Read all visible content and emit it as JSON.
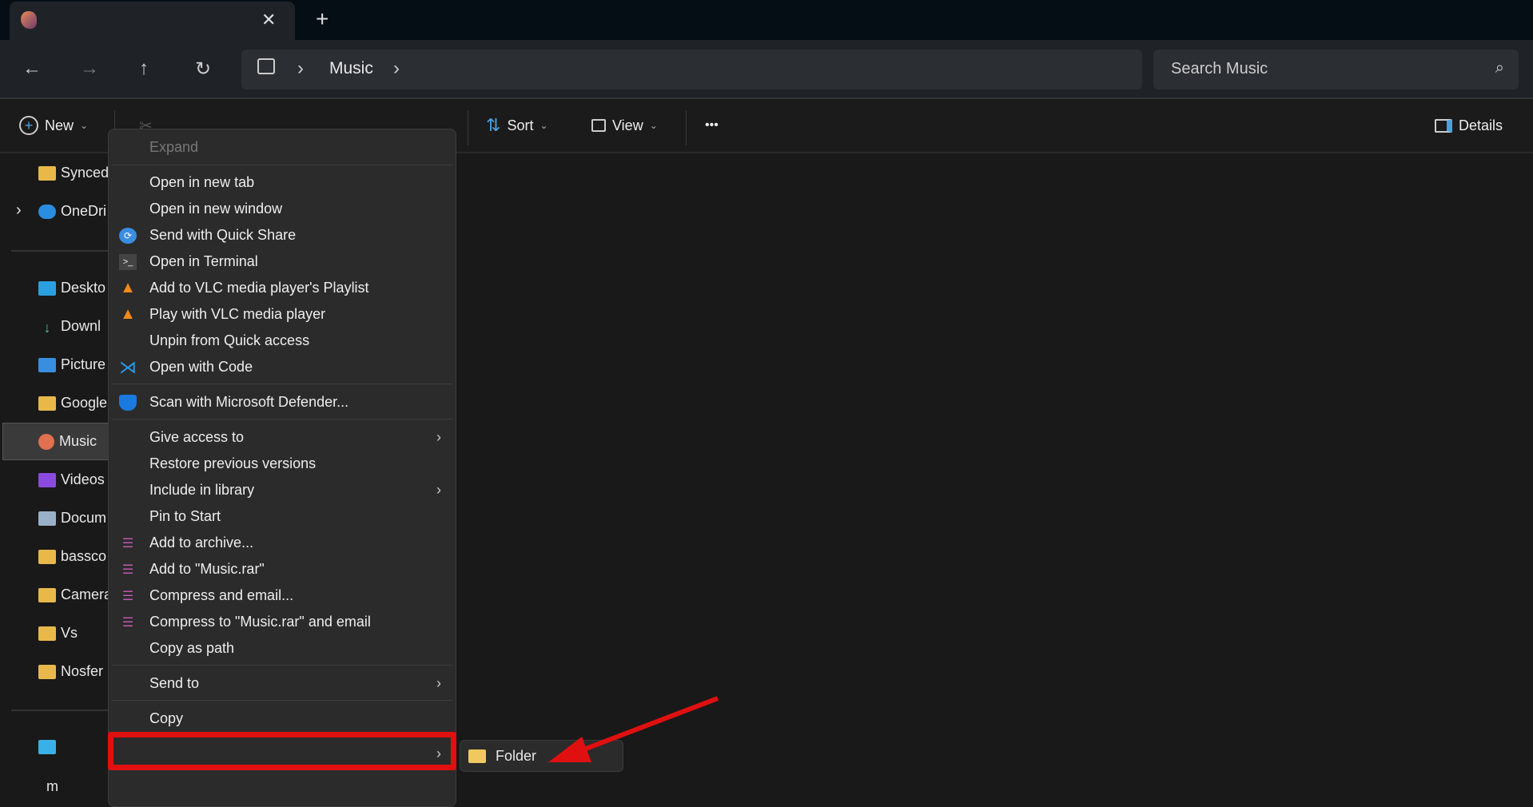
{
  "tab": {
    "close": "✕",
    "new": "+"
  },
  "nav": {
    "back": "←",
    "forward": "→",
    "up": "↑",
    "refresh": "↻"
  },
  "address": {
    "sep": "›",
    "crumb": "Music"
  },
  "search": {
    "placeholder": "Search Music",
    "icon": "⌕"
  },
  "toolbar": {
    "new": "New",
    "sort": "Sort",
    "view": "View",
    "more": "•••",
    "details": "Details",
    "chevron": "⌄"
  },
  "sidebar": {
    "items": [
      "Synced",
      "OneDri",
      "Deskto",
      "Downl",
      "Picture",
      "Google",
      "Music",
      "Videos",
      "Docum",
      "bassco",
      "Camera",
      "Vs",
      "Nosfer"
    ],
    "bottom": "m"
  },
  "menu": {
    "expand": "Expand",
    "group1": [
      "Open in new tab",
      "Open in new window",
      "Send with Quick Share",
      "Open in Terminal",
      "Add to VLC media player's Playlist",
      "Play with VLC media player",
      "Unpin from Quick access",
      "Open with Code"
    ],
    "defender": "Scan with Microsoft Defender...",
    "group2": [
      "Give access to",
      "Restore previous versions",
      "Include in library",
      "Pin to Start",
      "Add to archive...",
      "Add to \"Music.rar\"",
      "Compress and email...",
      "Compress to \"Music.rar\" and email",
      "Copy as path"
    ],
    "send_to": "Send to",
    "copy": "Copy",
    "chevron": "›"
  },
  "submenu": {
    "folder": "Folder"
  },
  "colors": {
    "annotation": "#e01010",
    "accent": "#4aa3e0"
  }
}
